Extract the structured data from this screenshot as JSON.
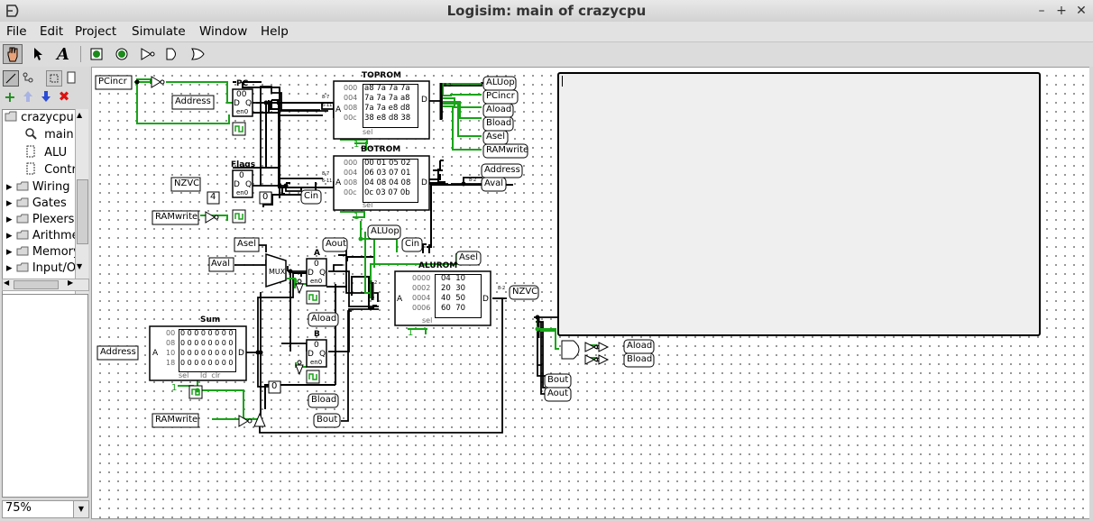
{
  "window": {
    "title": "Logisim: main of crazycpu",
    "min": "–",
    "max": "+",
    "close": "✕"
  },
  "menu": [
    "File",
    "Edit",
    "Project",
    "Simulate",
    "Window",
    "Help"
  ],
  "toolbar_icons": [
    "poke-tool-icon",
    "select-tool-icon",
    "text-tool-icon",
    "input-pin-icon",
    "output-pin-icon",
    "not-gate-icon",
    "and-gate-icon",
    "or-gate-icon"
  ],
  "explorer": {
    "project": "crazycpu",
    "circuits": [
      "main",
      "ALU",
      "Control"
    ],
    "libraries": [
      "Wiring",
      "Gates",
      "Plexers",
      "Arithmetic",
      "Memory",
      "Input/Output"
    ]
  },
  "zoom": "75%",
  "pins": {
    "pcincr": "PCincr",
    "address_in": "Address",
    "nzvc_in": "NZVC",
    "ramwrite1": "RAMwrite",
    "asel": "Asel",
    "aval": "Aval",
    "address2": "Address",
    "ramwrite2": "RAMwrite",
    "aout": "Aout",
    "aload": "Aload",
    "bload": "Bload",
    "bout": "Bout",
    "aluop": "ALUop",
    "cin": "Cin",
    "asel2": "Asel",
    "nzvc_out": "NZVC",
    "top_aluop": "ALUop",
    "top_pcincr": "PCincr",
    "top_aload": "Aload",
    "top_bload": "Bload",
    "top_asel": "Asel",
    "top_ramwrite": "RAMwrite",
    "bot_address": "Address",
    "bot_aval": "Aval",
    "cin2": "Cin",
    "right_aload": "Aload",
    "right_bload": "Bload",
    "right_bout": "Bout",
    "right_aout": "Aout"
  },
  "consts": {
    "four": "4",
    "zero1": "0",
    "zero2": "0",
    "one1": "1",
    "one2": "1",
    "one3": "1"
  },
  "components": {
    "pc": {
      "label": "PC",
      "val": "00",
      "d": "D",
      "q": "Q",
      "en": "en0"
    },
    "flags": {
      "label": "Flags",
      "val": "0",
      "d": "D",
      "q": "Q",
      "en": "en0"
    },
    "rega": {
      "label": "A",
      "val": "0",
      "d": "D",
      "q": "Q",
      "en": "en0"
    },
    "regb": {
      "label": "B",
      "val": "0",
      "d": "D",
      "q": "Q",
      "en": "en0"
    },
    "mux": "MUX",
    "toprom": {
      "label": "TOPROM",
      "addr": [
        "000",
        "004",
        "008",
        "00c"
      ],
      "rows": [
        "a8 7a 7a 7a",
        "7a 7a 7a a8",
        "7a 7a e8 d8",
        "38 e8 d8 38"
      ],
      "a": "A",
      "d": "D",
      "sel": "sel"
    },
    "botrom": {
      "label": "BOTROM",
      "addr": [
        "000",
        "004",
        "008",
        "00c"
      ],
      "rows": [
        "00 01 05 02",
        "06 03 07 01",
        "04 08 04 08",
        "0c 03 07 0b"
      ],
      "a": "A",
      "d": "D",
      "sel": "sel"
    },
    "alurom": {
      "label": "ALUROM",
      "addr": [
        "0000",
        "0002",
        "0004",
        "0006"
      ],
      "rows": [
        "04  10",
        "20  30",
        "40  50",
        "60  70"
      ],
      "a": "A",
      "d": "D",
      "sel": "sel"
    },
    "sum": {
      "label": "Sum",
      "addr": [
        "00",
        "08",
        "10",
        "18"
      ],
      "rows": [
        "0 0 0 0 0 0 0 0",
        "0 0 0 0 0 0 0 0",
        "0 0 0 0 0 0 0 0",
        "0 0 0 0 0 0 0 0"
      ],
      "a": "A",
      "d": "D",
      "foot": "sel     ld  clr"
    }
  }
}
